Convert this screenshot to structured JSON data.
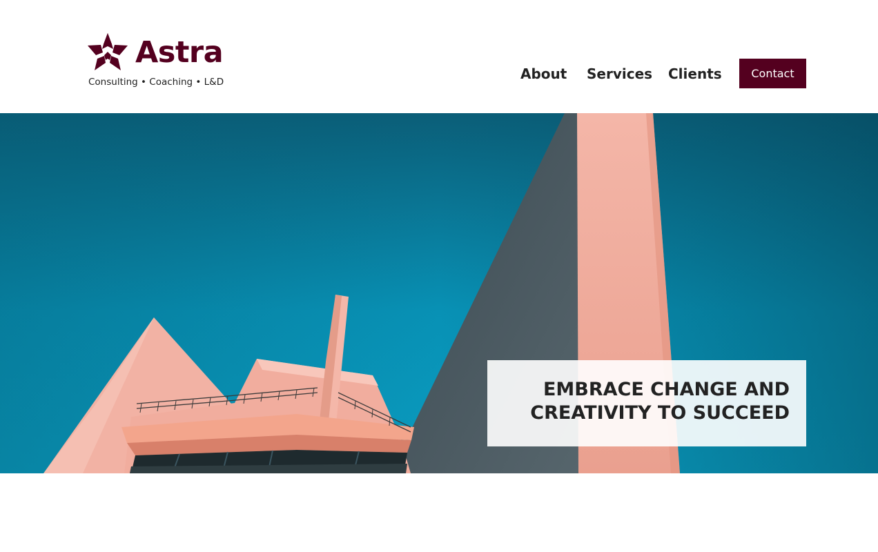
{
  "brand": {
    "name": "Astra",
    "tagline": "Consulting • Coaching • L&D",
    "logo_icon": "star-icon",
    "color": "#54001f"
  },
  "nav": {
    "items": [
      {
        "label": "About"
      },
      {
        "label": "Services"
      },
      {
        "label": "Clients"
      }
    ],
    "contact_label": "Contact"
  },
  "hero": {
    "heading": "EMBRACE CHANGE AND\nCREATIVITY TO SUCCEED",
    "image": "pink-modern-architecture-against-blue-sky",
    "sky_color": "#0a7fa0",
    "building_color": "#f2b3a6"
  }
}
